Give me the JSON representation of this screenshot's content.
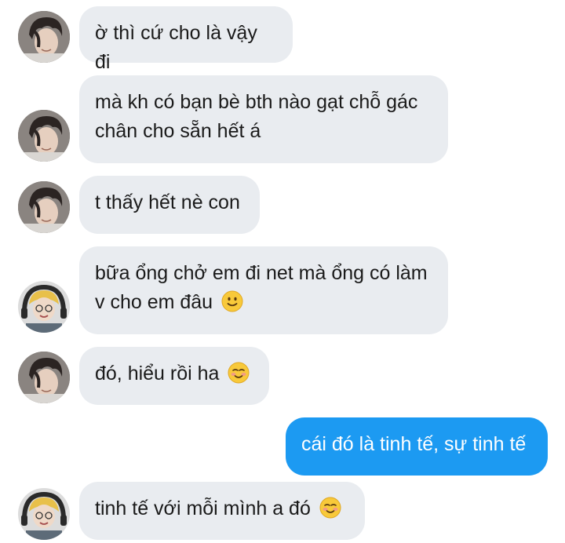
{
  "messages": [
    {
      "sender": "boy",
      "text": "ờ thì cứ cho là vậy đi",
      "emoji": ""
    },
    {
      "sender": "boy",
      "text": "mà kh có bạn bè bth nào gạt chỗ gác chân cho sẵn hết á",
      "emoji": ""
    },
    {
      "sender": "boy",
      "text": "t thấy hết nè con",
      "emoji": ""
    },
    {
      "sender": "girl",
      "text": "bữa ổng chở em đi net mà ổng có làm v cho em đâu",
      "emoji": "slightly-smiling-face"
    },
    {
      "sender": "boy",
      "text": "đó, hiểu rồi ha",
      "emoji": "smiling-face"
    },
    {
      "sender": "me",
      "text": "cái đó là tinh tế, sự tinh tế",
      "emoji": ""
    },
    {
      "sender": "girl",
      "text": "tinh tế với mỗi mình a đó",
      "emoji": "smiling-face"
    }
  ],
  "colors": {
    "incoming_bubble": "#e9ecf0",
    "outgoing_bubble": "#1c9af2",
    "incoming_text": "#1a1a1a",
    "outgoing_text": "#ffffff"
  }
}
